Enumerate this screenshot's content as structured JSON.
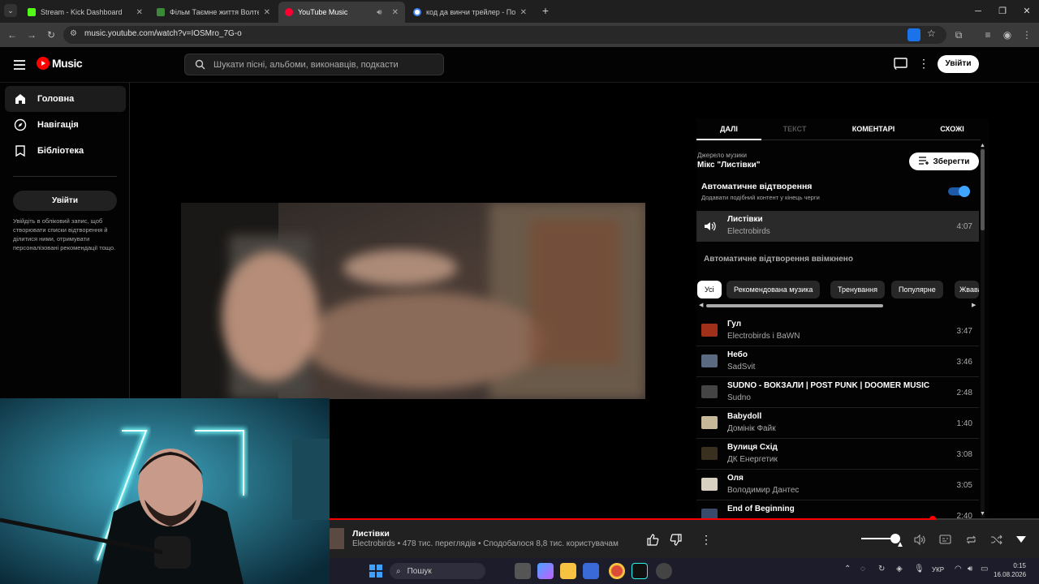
{
  "browser": {
    "tabs": [
      {
        "title": "Stream - Kick Dashboard",
        "favicon_color": "#53fc18"
      },
      {
        "title": "Фільм Таємне життя Волтера М",
        "favicon_color": "#3a8a3a"
      },
      {
        "title": "YouTube Music",
        "favicon_color": "#ff0033"
      },
      {
        "title": "код да винчи трейлер - Пошук",
        "favicon_color": "#4285f4"
      }
    ],
    "url": "music.youtube.com/watch?v=IOSMro_7G-o"
  },
  "header": {
    "logo_text": "Music",
    "search_placeholder": "Шукати пісні, альбоми, виконавців, подкасти",
    "signin_label": "Увійти"
  },
  "sidebar": {
    "items": [
      {
        "label": "Головна",
        "icon": "home-icon"
      },
      {
        "label": "Навігація",
        "icon": "compass-icon"
      },
      {
        "label": "Бібліотека",
        "icon": "library-icon"
      }
    ],
    "signin_label": "Увійти",
    "note": "Увійдіть в обліковий запис, щоб створювати списки відтворення й ділитися ними, отримувати персоналізовані рекомендації тощо."
  },
  "panel": {
    "tabs": [
      "ДАЛІ",
      "ТЕКСТ",
      "КОМЕНТАРІ",
      "СХОЖІ"
    ],
    "source_label": "Джерело музики",
    "source_name": "Мікс \"Листівки\"",
    "save_label": "Зберегти",
    "autoplay_title": "Автоматичне відтворення",
    "autoplay_sub": "Додавати подібний контент у кінець черги",
    "autoplay_on": true,
    "current": {
      "title": "Листівки",
      "artist": "Electrobirds",
      "duration": "4:07"
    },
    "autoplay_enabled_text": "Автоматичне відтворення ввімкнено",
    "chips": [
      "Усі",
      "Рекомендована музика",
      "Тренування",
      "Популярне",
      "Жвава"
    ],
    "queue": [
      {
        "title": "Гул",
        "artist": "Electrobirds і BaWN",
        "duration": "3:47",
        "thumb": "#a0301a"
      },
      {
        "title": "Небо",
        "artist": "SadSvit",
        "duration": "3:46",
        "thumb": "#5a6a80"
      },
      {
        "title": "SUDNO - ВОКЗАЛИ | POST PUNK | DOOMER MUSIC",
        "artist": "Sudno",
        "duration": "2:48",
        "thumb": "#444"
      },
      {
        "title": "Babydoll",
        "artist": "Домінік Файк",
        "duration": "1:40",
        "thumb": "#c8b89a"
      },
      {
        "title": "Вулиця Схід",
        "artist": "ДК Енергетик",
        "duration": "3:08",
        "thumb": "#3a3020"
      },
      {
        "title": "Оля",
        "artist": "Володимир Дантес",
        "duration": "3:05",
        "thumb": "#d8d0c0"
      },
      {
        "title": "End of Beginning",
        "artist": "",
        "duration": "2:40",
        "thumb": "#3a4a6a"
      }
    ]
  },
  "player": {
    "title": "Листівки",
    "meta": "Electrobirds • 478 тис. переглядів • Сподобалося 8,8 тис. користувачам",
    "progress": 0.85
  },
  "taskbar": {
    "search_label": "Пошук",
    "lang": "УКР",
    "time": "0:15",
    "date": "16.08.2026"
  }
}
